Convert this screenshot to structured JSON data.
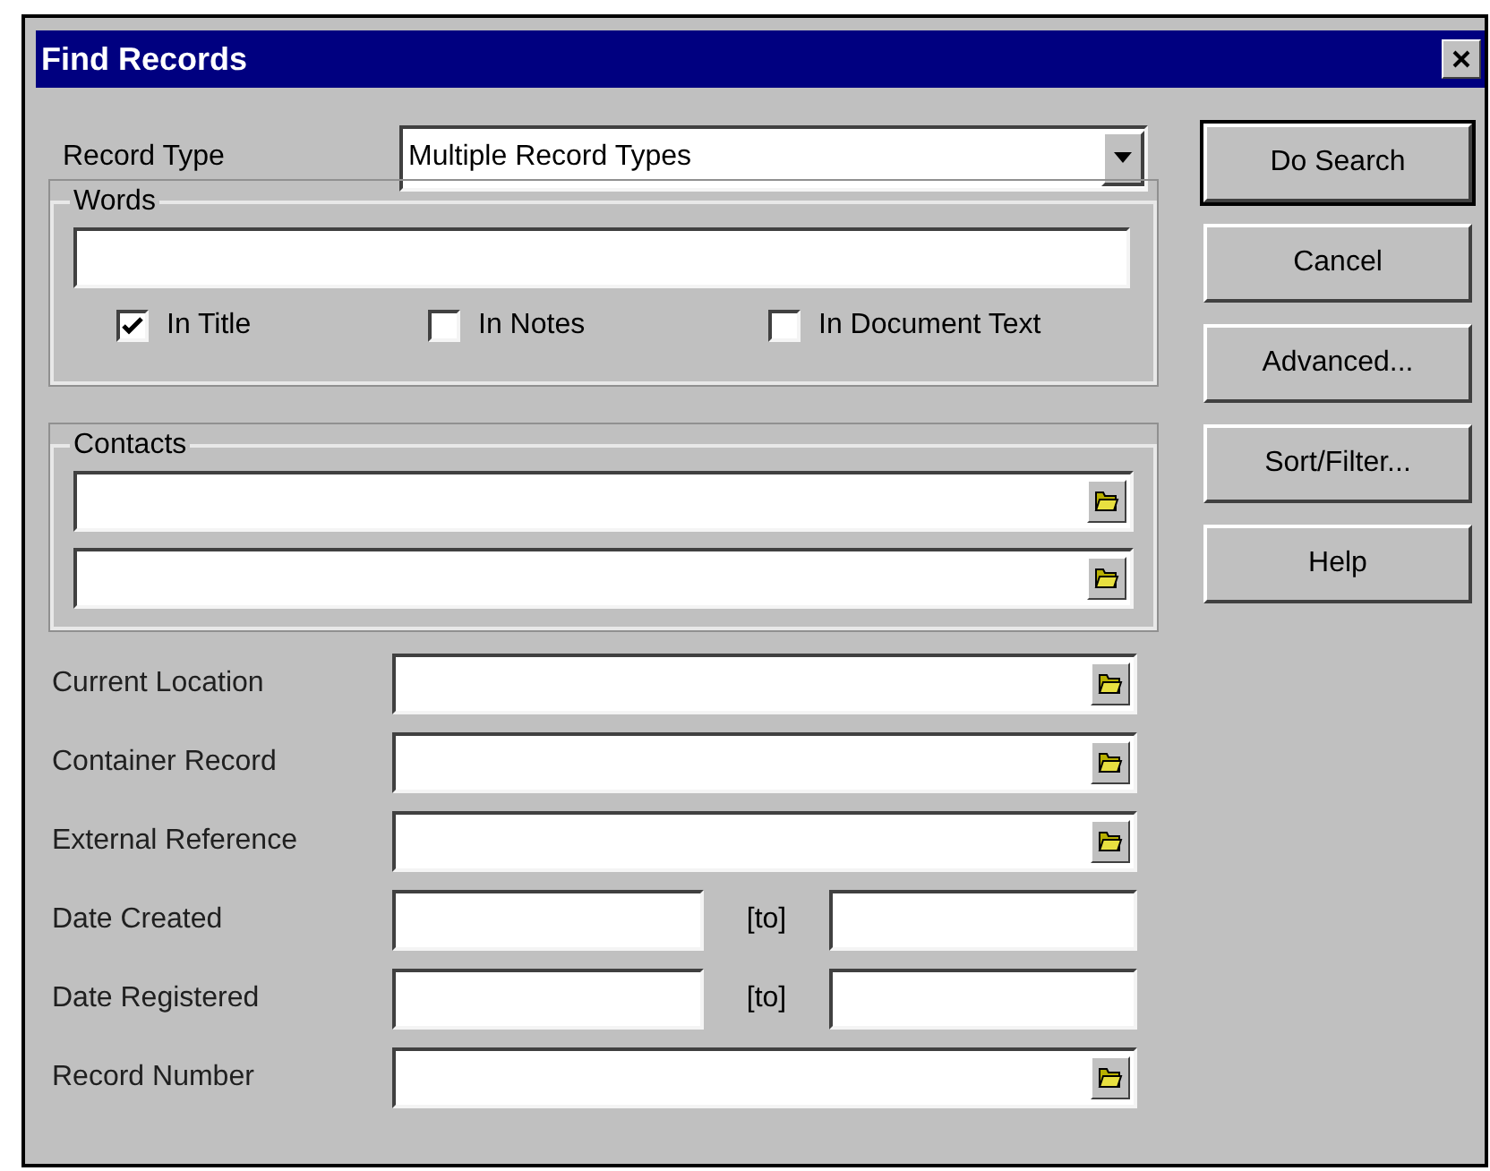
{
  "window": {
    "title": "Find Records"
  },
  "record_type": {
    "label": "Record Type",
    "value": "Multiple Record Types"
  },
  "words": {
    "legend": "Words",
    "options": [
      {
        "label": "In Title",
        "checked": true
      },
      {
        "label": "In Notes",
        "checked": false
      },
      {
        "label": "In Document Text",
        "checked": false
      }
    ]
  },
  "contacts": {
    "legend": "Contacts",
    "field_count_rows": [
      {
        "kind": "lookup"
      },
      {
        "kind": "lookup"
      }
    ]
  },
  "fields": [
    {
      "label": "Current Location",
      "kind": "lookup"
    },
    {
      "label": "Container Record",
      "kind": "lookup"
    },
    {
      "label": "External Reference",
      "kind": "lookup"
    },
    {
      "label": "Date Created",
      "kind": "range",
      "separator": "[to]"
    },
    {
      "label": "Date Registered",
      "kind": "range",
      "separator": "[to]"
    },
    {
      "label": "Record Number",
      "kind": "lookup"
    }
  ],
  "buttons": [
    {
      "label": "Do Search",
      "default": true
    },
    {
      "label": "Cancel",
      "default": false
    },
    {
      "label": "Advanced...",
      "default": false
    },
    {
      "label": "Sort/Filter...",
      "default": false
    },
    {
      "label": "Help",
      "default": false
    }
  ]
}
